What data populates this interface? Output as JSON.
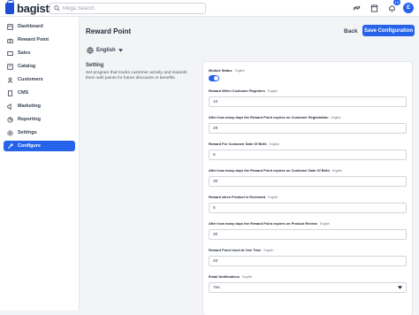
{
  "app": {
    "logo_text": "bagisto"
  },
  "search": {
    "placeholder": "Mega Search"
  },
  "header": {
    "notification_count": "12",
    "avatar_initial": "E"
  },
  "sidebar": {
    "items": [
      {
        "label": "Dashboard",
        "icon": "dashboard-icon"
      },
      {
        "label": "Reward Point",
        "icon": "gift-icon"
      },
      {
        "label": "Sales",
        "icon": "sales-icon"
      },
      {
        "label": "Catalog",
        "icon": "catalog-icon"
      },
      {
        "label": "Customers",
        "icon": "customers-icon"
      },
      {
        "label": "CMS",
        "icon": "cms-icon"
      },
      {
        "label": "Marketing",
        "icon": "marketing-icon"
      },
      {
        "label": "Reporting",
        "icon": "reporting-icon"
      },
      {
        "label": "Settings",
        "icon": "settings-icon"
      },
      {
        "label": "Configure",
        "icon": "configure-icon"
      }
    ],
    "active_index": 9
  },
  "page": {
    "title": "Reward Point",
    "back_label": "Back",
    "save_label": "Save Configuration",
    "locale": "English",
    "section_title": "Setting",
    "section_desc": "Set program that tracks customer activity and rewards them with points for future discounts or benefits."
  },
  "form": {
    "locale_tag": "English",
    "module_status_label": "Module Status",
    "module_status_enabled": true,
    "fields": [
      {
        "label": "Reward When Customer Registers",
        "value": "10"
      },
      {
        "label": "After how many days the Reward Point expires on Customer Registration",
        "value": "29"
      },
      {
        "label": "Reward For Customer Date Of Birth",
        "value": "5"
      },
      {
        "label": "After how many days the Reward Point expires on Customer Date Of Birth",
        "value": "30"
      },
      {
        "label": "Reward when Product is Reviewed",
        "value": "5"
      },
      {
        "label": "After how many days the Reward Point expires on Product Review",
        "value": "30"
      },
      {
        "label": "Reward Point Used At One Time",
        "value": "20"
      }
    ],
    "email_label": "Email Notifications",
    "email_value": "Yes"
  },
  "colors": {
    "accent": "#2563eb"
  }
}
